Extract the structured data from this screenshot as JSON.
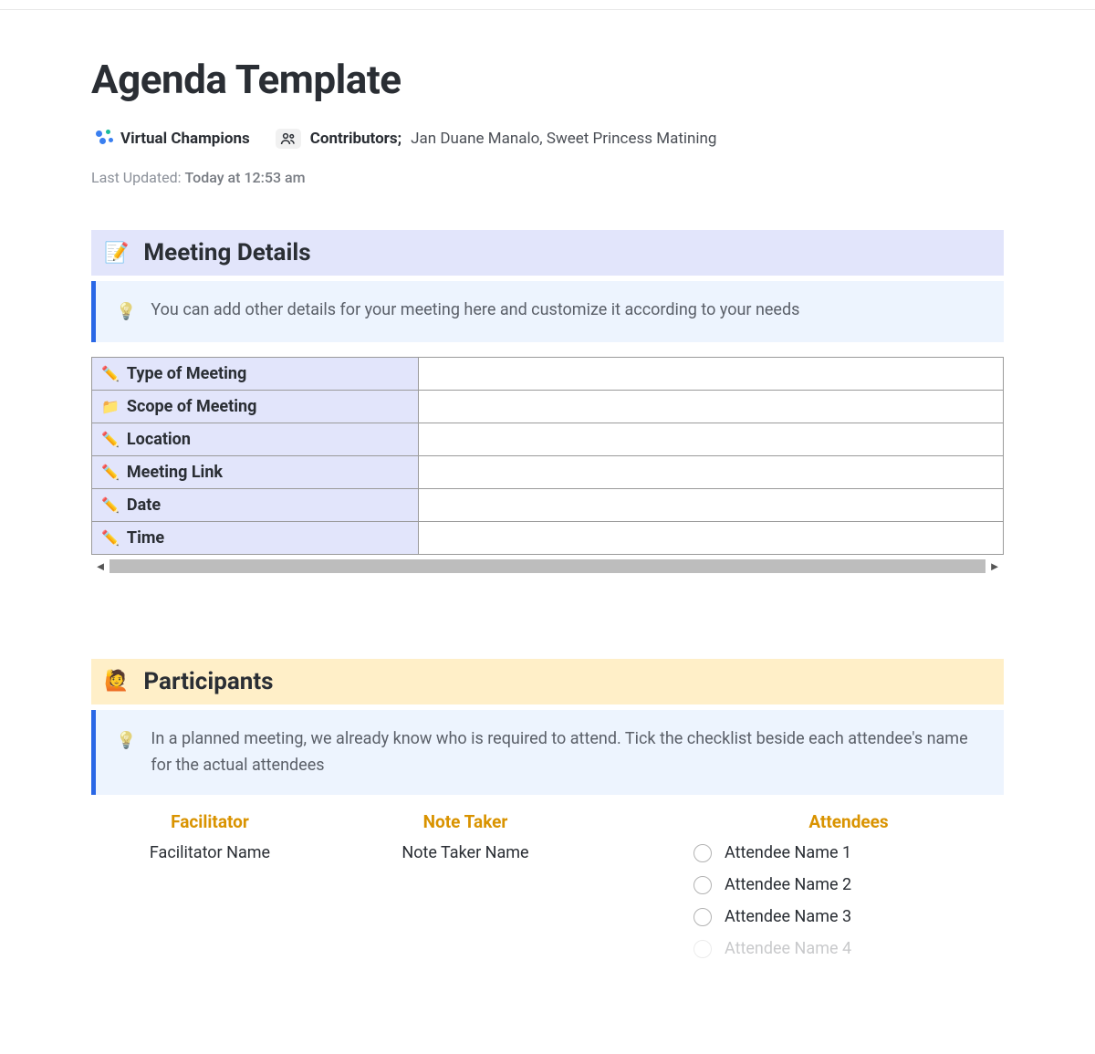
{
  "title": "Agenda Template",
  "workspace": "Virtual Champions",
  "contributors_label": "Contributors",
  "contributors_value": "Jan Duane Manalo, Sweet Princess Matining",
  "last_updated_label": "Last Updated:",
  "last_updated_value": "Today at 12:53 am",
  "meeting_details": {
    "heading": "Meeting Details",
    "callout": "You can add other details for your meeting here and customize it according to your needs",
    "rows": [
      {
        "label": "Type of Meeting",
        "icon": "pencil",
        "value": ""
      },
      {
        "label": "Scope of Meeting",
        "icon": "folder",
        "value": ""
      },
      {
        "label": "Location",
        "icon": "pencil",
        "value": ""
      },
      {
        "label": "Meeting Link",
        "icon": "pencil",
        "value": ""
      },
      {
        "label": "Date",
        "icon": "pencil",
        "value": ""
      },
      {
        "label": "Time",
        "icon": "pencil",
        "value": ""
      }
    ]
  },
  "participants": {
    "heading": "Participants",
    "callout": "In a planned meeting, we already know who is required to attend. Tick the checklist beside each attendee's name for the actual attendees",
    "facilitator_label": "Facilitator",
    "facilitator_value": "Facilitator Name",
    "note_taker_label": "Note Taker",
    "note_taker_value": "Note Taker Name",
    "attendees_label": "Attendees",
    "attendees": [
      "Attendee Name 1",
      "Attendee Name 2",
      "Attendee Name 3",
      "Attendee Name 4"
    ]
  }
}
